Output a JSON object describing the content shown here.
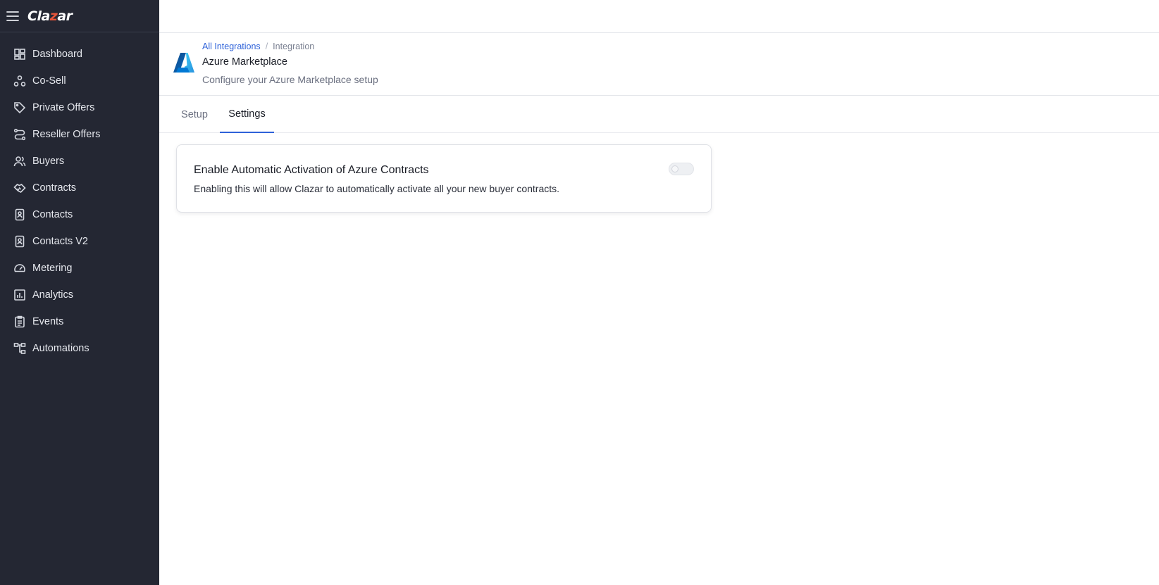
{
  "app": {
    "logo_prefix": "Cla",
    "logo_accent": "z",
    "logo_suffix": "ar",
    "brand_color": "#e8553a",
    "sidebar_bg": "#242733",
    "accent_color": "#2e62d9"
  },
  "sidebar": {
    "items": [
      {
        "label": "Dashboard",
        "icon": "dashboard-icon"
      },
      {
        "label": "Co-Sell",
        "icon": "cosell-icon"
      },
      {
        "label": "Private Offers",
        "icon": "tag-icon"
      },
      {
        "label": "Reseller Offers",
        "icon": "route-icon"
      },
      {
        "label": "Buyers",
        "icon": "users-icon"
      },
      {
        "label": "Contracts",
        "icon": "handshake-icon"
      },
      {
        "label": "Contacts",
        "icon": "contact-card-icon"
      },
      {
        "label": "Contacts V2",
        "icon": "contact-card-icon"
      },
      {
        "label": "Metering",
        "icon": "gauge-icon"
      },
      {
        "label": "Analytics",
        "icon": "bar-chart-icon"
      },
      {
        "label": "Events",
        "icon": "clipboard-icon"
      },
      {
        "label": "Automations",
        "icon": "workflow-icon"
      }
    ]
  },
  "header": {
    "breadcrumb": {
      "link": "All Integrations",
      "separator": "/",
      "current": "Integration"
    },
    "title": "Azure Marketplace",
    "subtitle": "Configure your Azure Marketplace setup"
  },
  "tabs": [
    {
      "label": "Setup",
      "active": false
    },
    {
      "label": "Settings",
      "active": true
    }
  ],
  "settings_card": {
    "title": "Enable Automatic Activation of Azure Contracts",
    "description": "Enabling this will allow Clazar to automatically activate all your new buyer contracts.",
    "toggle_enabled": false
  }
}
